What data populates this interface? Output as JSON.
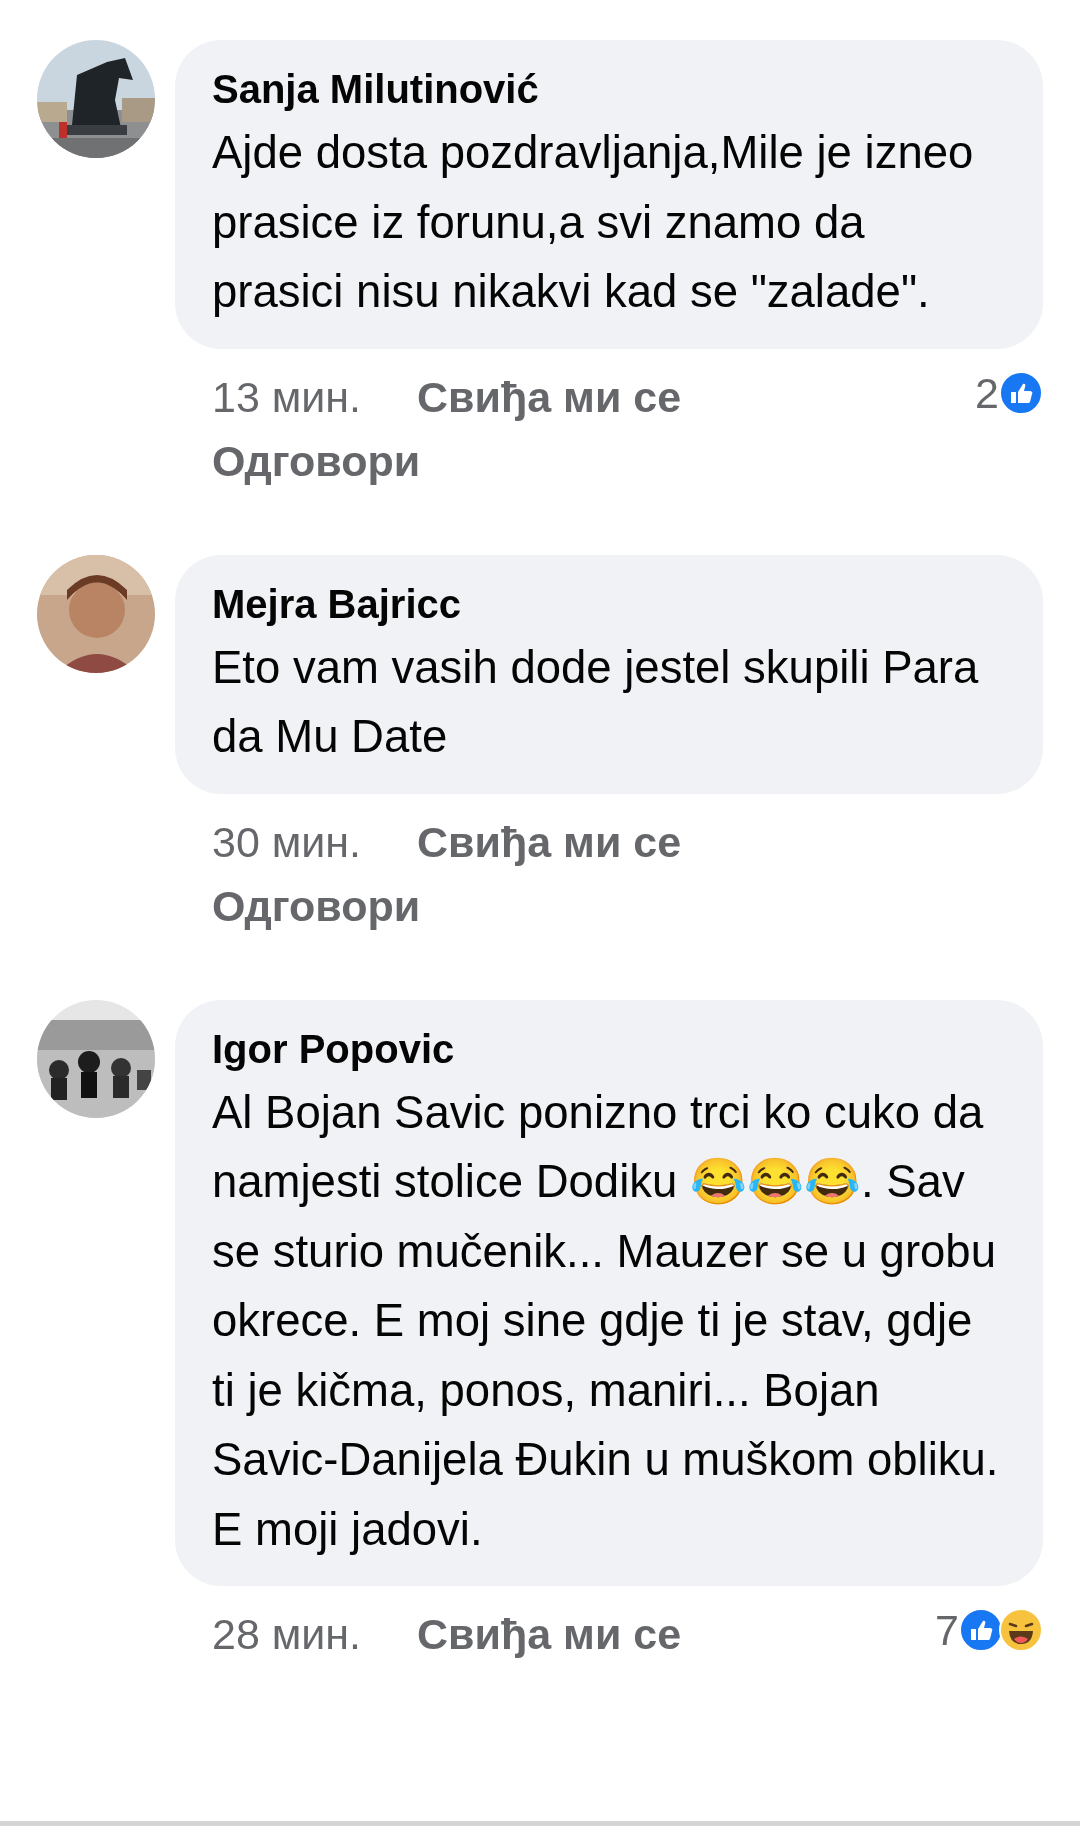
{
  "comments": [
    {
      "author": "Sanja Milutinović",
      "text": "Ajde dosta pozdravljanja,Mile je izneo prasice iz forunu,a svi znamo da prasici nisu nikakvi kad se \"zalade\".",
      "time": "13 мин.",
      "like_label": "Свиђа ми се",
      "reply_label": "Одговори",
      "reaction_count": "2",
      "reactions": [
        {
          "kind": "like"
        }
      ]
    },
    {
      "author": "Mejra Bajricc",
      "text": "Eto vam vasih dode jestel skupili Para da Mu Date",
      "time": "30 мин.",
      "like_label": "Свиђа ми се",
      "reply_label": "Одговори"
    },
    {
      "author": "Igor Popovic",
      "text": "Al Bojan Savic ponizno trci ko cuko da namjesti stolice Dodiku 😂😂😂. Sav se sturio mučenik... Mauzer se u grobu okrece. E moj sine gdje ti je stav, gdje ti je kičma, ponos, maniri... Bojan Savic-Danijela Đukin u muškom obliku. E moji jadovi.",
      "time": "28 мин.",
      "like_label": "Свиђа ми се",
      "reaction_count": "7",
      "reactions": [
        {
          "kind": "like"
        },
        {
          "kind": "haha"
        }
      ]
    }
  ]
}
